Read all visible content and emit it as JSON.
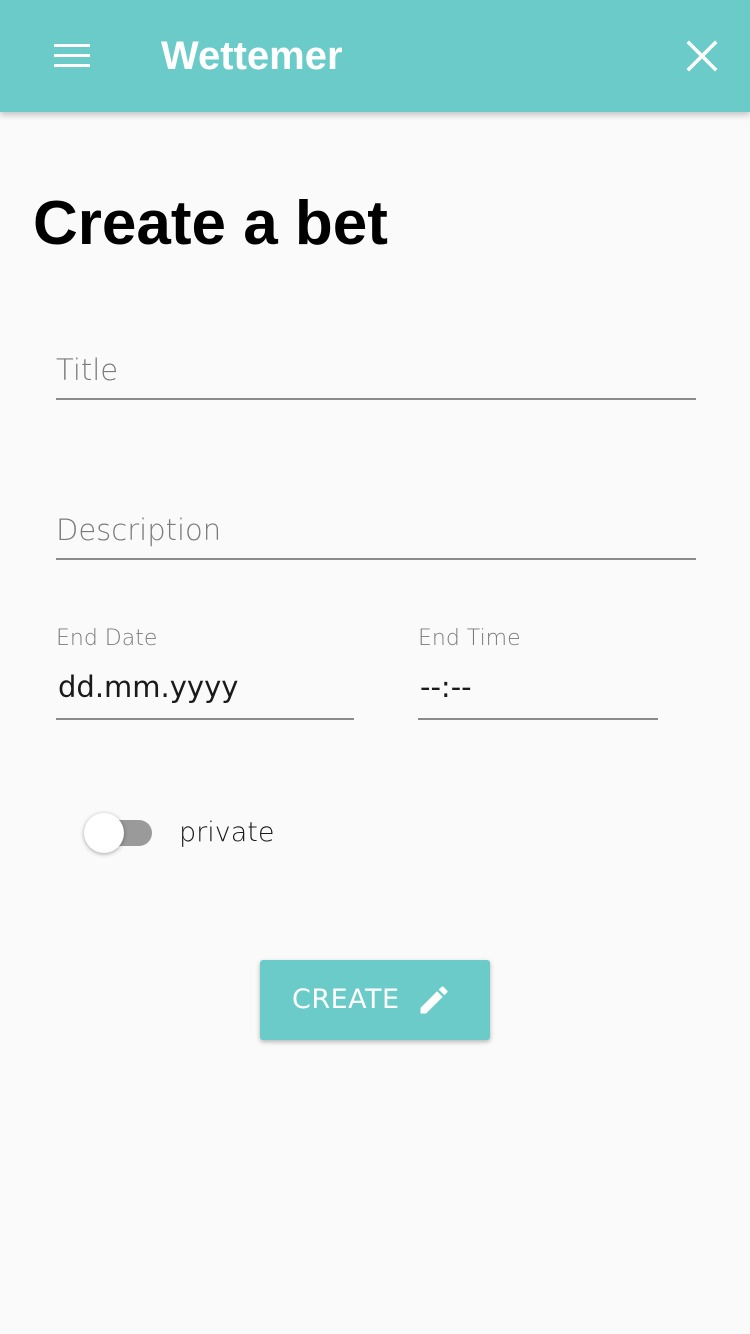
{
  "app_bar": {
    "title": "Wettemer",
    "menu_icon": "hamburger-menu-icon",
    "close_icon": "close-icon",
    "color": "#6bcbc9"
  },
  "page": {
    "title": "Create a bet"
  },
  "form": {
    "title_placeholder": "Title",
    "description_placeholder": "Description",
    "end_date_label": "End Date",
    "end_date_value": "dd.mm.yyyy",
    "end_time_label": "End Time",
    "end_time_value": "--:--",
    "private_label": "private",
    "private_enabled": false
  },
  "actions": {
    "create_label": "CREATE",
    "create_icon": "pencil-icon"
  }
}
